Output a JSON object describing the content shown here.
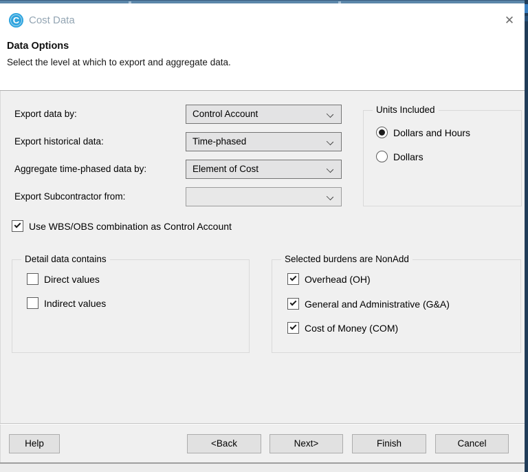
{
  "window": {
    "title": "Cost Data",
    "icon_letter": "C",
    "close_glyph": "✕"
  },
  "header": {
    "title": "Data Options",
    "subtitle": "Select the level at which to export and aggregate data."
  },
  "fields": [
    {
      "label": "Export data by:",
      "value": "Control Account",
      "disabled": false
    },
    {
      "label": "Export historical data:",
      "value": "Time-phased",
      "disabled": false
    },
    {
      "label": "Aggregate time-phased data by:",
      "value": "Element of Cost",
      "disabled": false
    },
    {
      "label": "Export Subcontractor from:",
      "value": "",
      "disabled": true
    }
  ],
  "units_group": {
    "title": "Units Included",
    "options": [
      {
        "label": "Dollars and Hours",
        "selected": true
      },
      {
        "label": "Dollars",
        "selected": false
      }
    ]
  },
  "wbs_checkbox": {
    "label": "Use WBS/OBS combination as Control Account",
    "checked": true
  },
  "detail_group": {
    "title": "Detail data contains",
    "options": [
      {
        "label": "Direct values",
        "checked": false
      },
      {
        "label": "Indirect values",
        "checked": false
      }
    ]
  },
  "burdens_group": {
    "title": "Selected burdens are NonAdd",
    "options": [
      {
        "label": "Overhead (OH)",
        "checked": true
      },
      {
        "label": "General and Administrative (G&A)",
        "checked": true
      },
      {
        "label": "Cost of Money (COM)",
        "checked": true
      }
    ]
  },
  "buttons": {
    "help": "Help",
    "back": "<Back",
    "next": "Next>",
    "finish": "Finish",
    "cancel": "Cancel"
  },
  "colors": {
    "app_icon_blue": "#2fa4de",
    "titlebar_text": "#93a5b3",
    "body_gray": "#f0f0f0",
    "bg_window_steel_blue": "#5b86a9",
    "bg_window_navy": "#203c58",
    "control_border": "#747474",
    "button_face": "#e1e1e1"
  }
}
